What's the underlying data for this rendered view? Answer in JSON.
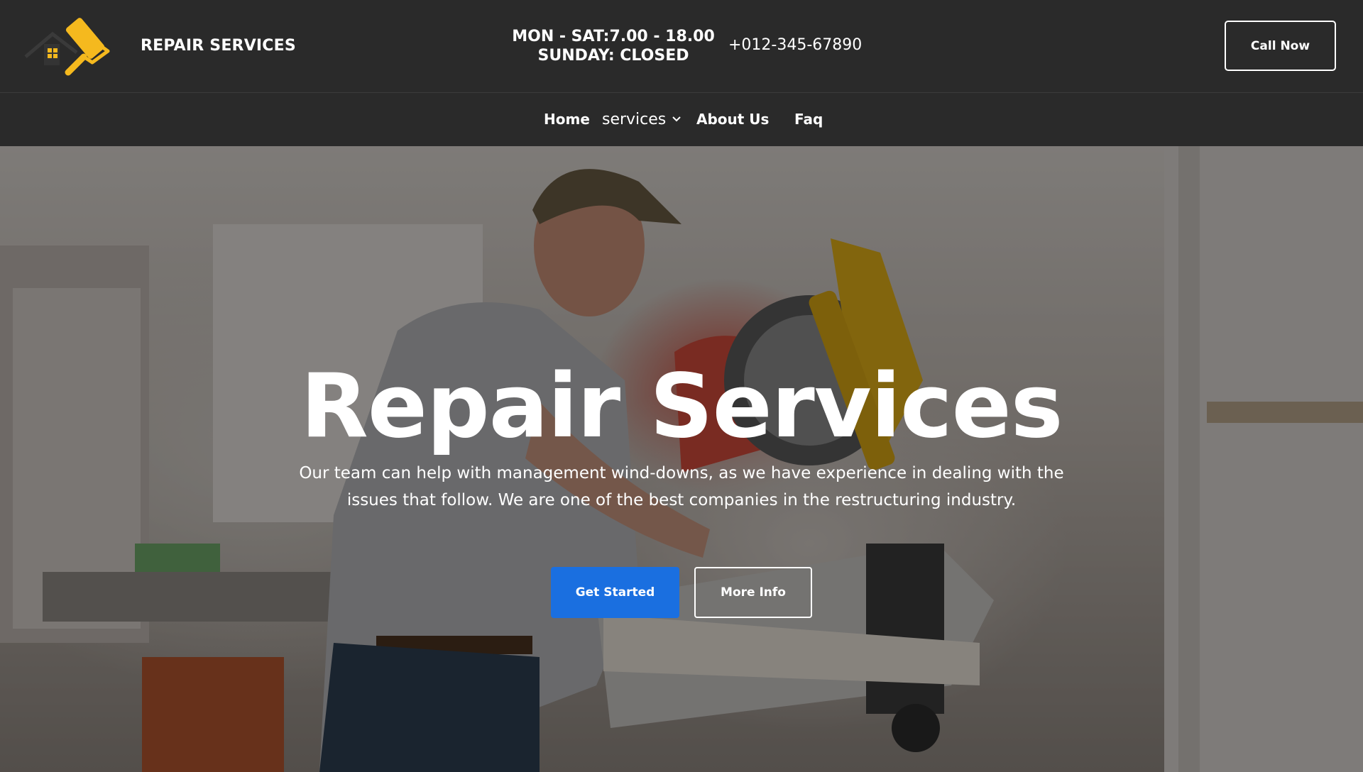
{
  "header": {
    "brand": "REPAIR SERVICES",
    "hours_line1": "MON - SAT:7.00 - 18.00",
    "hours_line2": "SUNDAY: CLOSED",
    "phone": "+012-345-67890",
    "call_button": "Call Now",
    "logo_icon": "paint-roller-house-icon"
  },
  "nav": {
    "items": [
      {
        "label": "Home"
      },
      {
        "label": "services",
        "has_dropdown": true
      },
      {
        "label": "About Us"
      },
      {
        "label": "Faq"
      }
    ]
  },
  "hero": {
    "title": "Repair Services",
    "text": "Our team can help with management wind-downs, as we have experience in dealing with the issues that follow. We are one of the best companies in the restructuring industry.",
    "primary_button": "Get Started",
    "secondary_button": "More Info"
  },
  "colors": {
    "header_bg": "#2a2a2a",
    "accent_yellow": "#f5b91e",
    "primary_blue": "#1a6fe0"
  }
}
